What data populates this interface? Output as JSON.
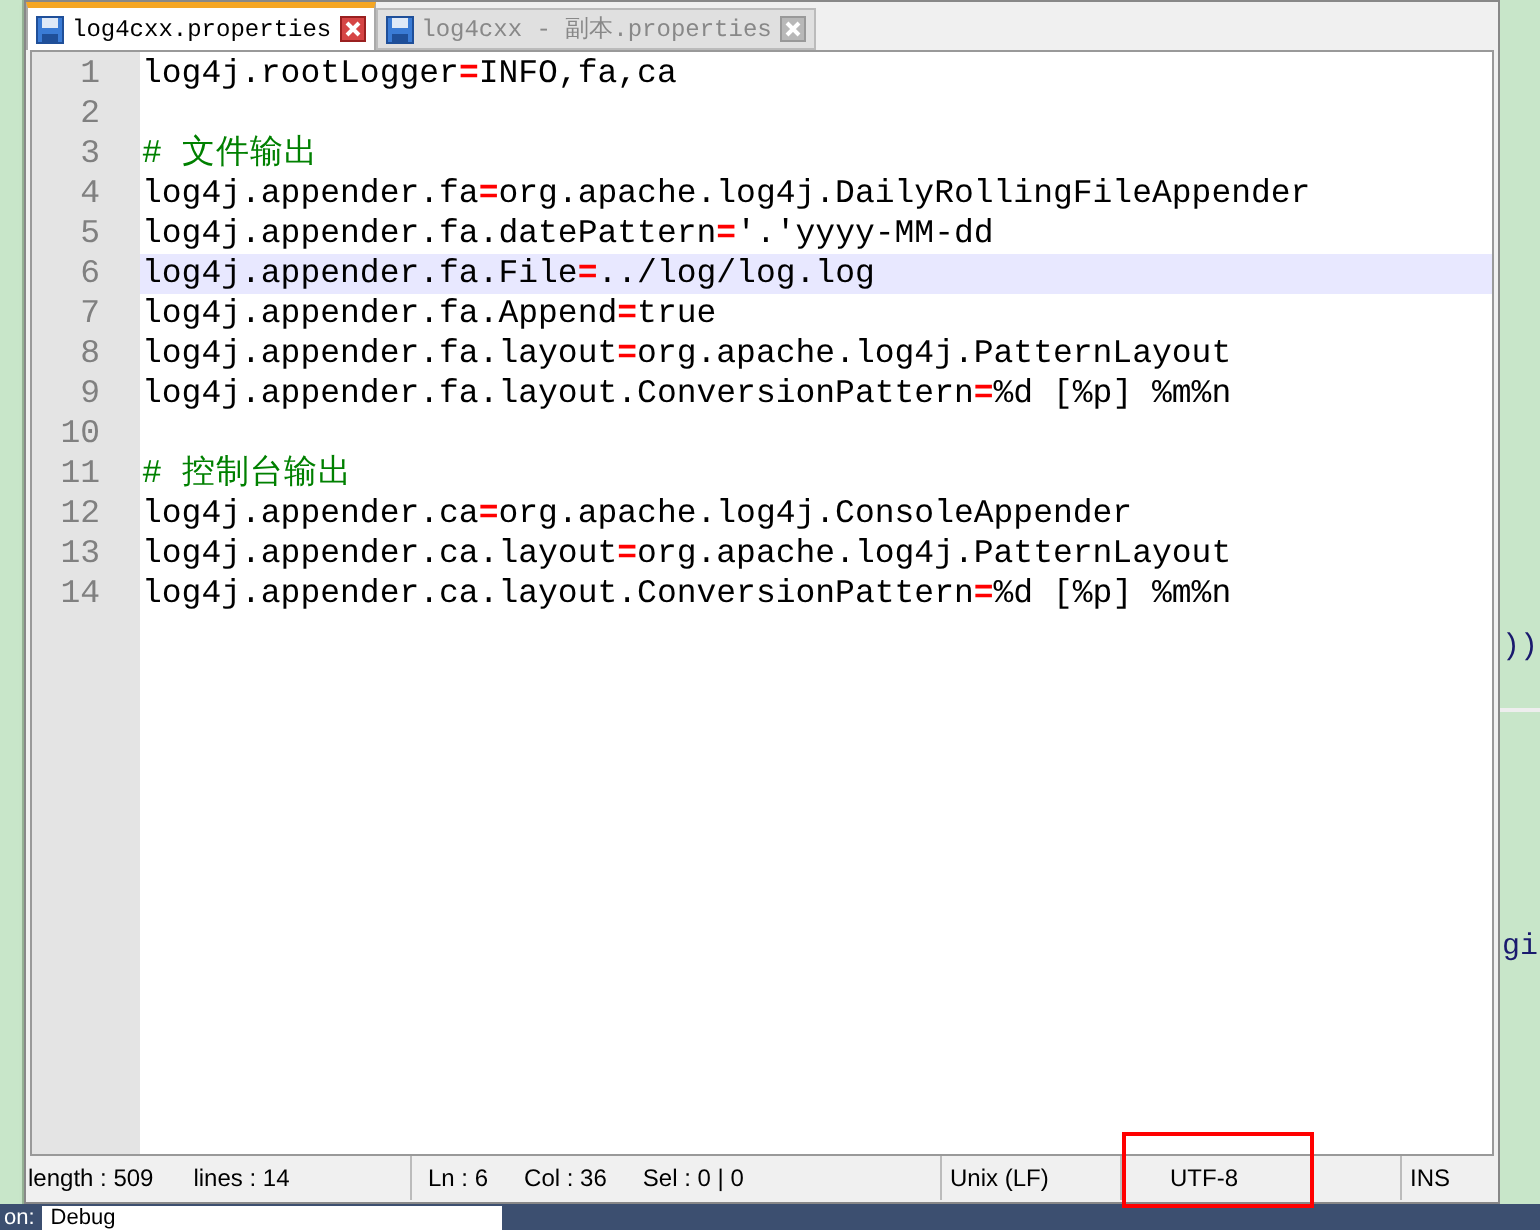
{
  "tabs": [
    {
      "label": "log4cxx.properties",
      "selected": true
    },
    {
      "label": "log4cxx - 副本.properties",
      "selected": false
    }
  ],
  "lines": [
    {
      "number": "1",
      "kind": "code",
      "key": "log4j.rootLogger",
      "op": "=",
      "value": "INFO,fa,ca",
      "current": false
    },
    {
      "number": "2",
      "kind": "blank",
      "current": false
    },
    {
      "number": "3",
      "kind": "comment",
      "text": "# 文件输出",
      "current": false
    },
    {
      "number": "4",
      "kind": "code",
      "key": "log4j.appender.fa",
      "op": "=",
      "value": "org.apache.log4j.DailyRollingFileAppender",
      "current": false
    },
    {
      "number": "5",
      "kind": "code",
      "key": "log4j.appender.fa.datePattern",
      "op": "=",
      "value": "'.'yyyy-MM-dd",
      "current": false
    },
    {
      "number": "6",
      "kind": "code",
      "key": "log4j.appender.fa.File",
      "op": "=",
      "value": "../log/log.log",
      "current": true
    },
    {
      "number": "7",
      "kind": "code",
      "key": "log4j.appender.fa.Append",
      "op": "=",
      "value": "true",
      "current": false
    },
    {
      "number": "8",
      "kind": "code",
      "key": "log4j.appender.fa.layout",
      "op": "=",
      "value": "org.apache.log4j.PatternLayout",
      "current": false
    },
    {
      "number": "9",
      "kind": "code",
      "key": "log4j.appender.fa.layout.ConversionPattern",
      "op": "=",
      "value": "%d [%p] %m%n",
      "current": false
    },
    {
      "number": "10",
      "kind": "blank",
      "current": false
    },
    {
      "number": "11",
      "kind": "comment",
      "text": "# 控制台输出",
      "current": false
    },
    {
      "number": "12",
      "kind": "code",
      "key": "log4j.appender.ca",
      "op": "=",
      "value": "org.apache.log4j.ConsoleAppender",
      "current": false
    },
    {
      "number": "13",
      "kind": "code",
      "key": "log4j.appender.ca.layout",
      "op": "=",
      "value": "org.apache.log4j.PatternLayout",
      "current": false
    },
    {
      "number": "14",
      "kind": "code",
      "key": "log4j.appender.ca.layout.ConversionPattern",
      "op": "=",
      "value": "%d [%p] %m%n",
      "current": false
    }
  ],
  "status_bar": {
    "length": "length : 509",
    "lines": "lines : 14",
    "ln": "Ln : 6",
    "col": "Col : 36",
    "sel": "Sel : 0 | 0",
    "eol": "Unix (LF)",
    "encoding": "UTF-8",
    "mode": "INS",
    "encoding_highlighted": true
  },
  "background": {
    "code_1": "))",
    "code_2": "gi",
    "bottom_label": "on:",
    "bottom_value": "Debug"
  }
}
